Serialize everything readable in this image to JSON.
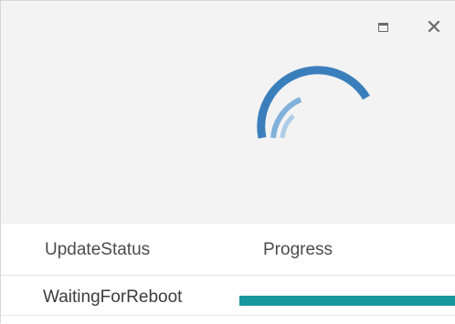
{
  "window": {
    "controls": [
      {
        "name": "maximize",
        "icon": "maximize-icon"
      },
      {
        "name": "close",
        "icon": "close-icon",
        "glyph": "✕"
      }
    ]
  },
  "spinner": {
    "icon": "loading-spinner-icon",
    "color": "#2f78b8"
  },
  "grid": {
    "columns": [
      "UpdateStatus",
      "Progress"
    ],
    "rows": [
      {
        "status": "WaitingForReboot",
        "progress": 1.0
      }
    ],
    "progress_color": "#17969e"
  }
}
